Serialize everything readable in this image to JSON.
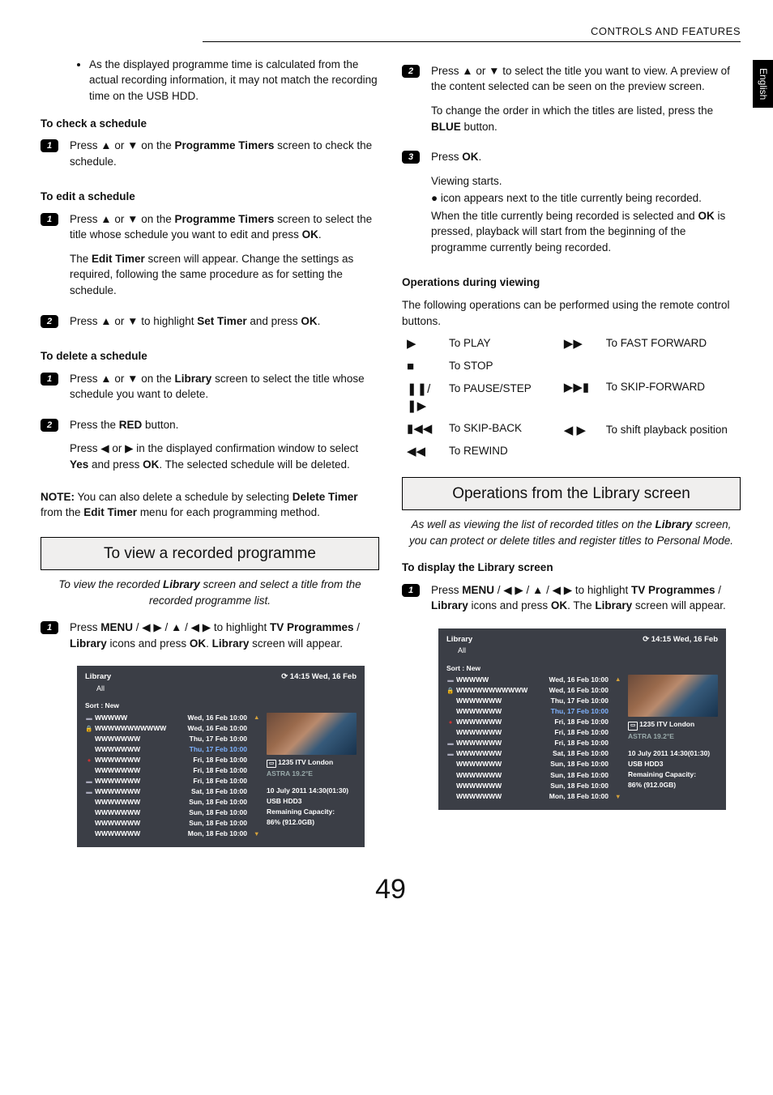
{
  "header": "CONTROLS AND FEATURES",
  "side_tab": "English",
  "page_number": "49",
  "left": {
    "bullet1": "As the displayed programme time is calculated from the actual recording information, it may not match the recording time on the USB HDD.",
    "h_check": "To check a schedule",
    "check1_a": "Press ▲ or ▼ on the ",
    "check1_b": "Programme Timers",
    "check1_c": " screen to check the schedule.",
    "h_edit": "To edit a schedule",
    "edit1_a": "Press ▲ or ▼ on the ",
    "edit1_b": "Programme Timers",
    "edit1_c": " screen to select the title whose schedule you want to edit and press ",
    "edit1_d": "OK",
    "edit1_e": ".",
    "edit1_p2a": "The ",
    "edit1_p2b": "Edit Timer",
    "edit1_p2c": " screen will appear. Change the settings as required, following the same procedure as for setting the schedule.",
    "edit2_a": "Press ▲ or ▼ to highlight ",
    "edit2_b": "Set Timer",
    "edit2_c": " and press ",
    "edit2_d": "OK",
    "edit2_e": ".",
    "h_del": "To delete a schedule",
    "del1_a": "Press ▲ or ▼ on the ",
    "del1_b": "Library",
    "del1_c": " screen to select the title whose schedule you want to delete.",
    "del2_a": "Press the ",
    "del2_b": "RED",
    "del2_c": " button.",
    "del2_p2a": "Press ◀ or ▶ in the displayed confirmation window to select ",
    "del2_p2b": "Yes",
    "del2_p2c": " and press ",
    "del2_p2d": "OK",
    "del2_p2e": ". The selected schedule will be deleted.",
    "note_a": "NOTE:",
    "note_b": " You can also delete a schedule by selecting ",
    "note_c": "Delete Timer",
    "note_d": " from the ",
    "note_e": "Edit Timer",
    "note_f": " menu for each programming method.",
    "sec_view": "To view a recorded programme",
    "sec_view_intro_a": "To view the recorded ",
    "sec_view_intro_b": "Library",
    "sec_view_intro_c": " screen and select a title from the recorded programme list.",
    "view1_a": "Press ",
    "view1_b": "MENU",
    "view1_c": " / ◀ ▶ / ▲ / ◀ ▶ to highlight ",
    "view1_d": "TV Programmes",
    "view1_e": " / ",
    "view1_f": "Library",
    "view1_g": " icons and press ",
    "view1_h": "OK",
    "view1_i": ". ",
    "view1_j": "Library",
    "view1_k": " screen will appear."
  },
  "right": {
    "r2_a": "Press ▲ or ▼ to select the title you want to view. A preview of the content selected can be seen on the preview screen.",
    "r2_b": "To change the order in which the titles are listed, press the ",
    "r2_c": "BLUE",
    "r2_d": " button.",
    "r3_a": "Press ",
    "r3_b": "OK",
    "r3_c": ".",
    "r3_p2": "Viewing starts.",
    "r3_p3": "● icon appears next to the title currently being recorded.",
    "r3_p4a": "When the title currently being recorded is selected and ",
    "r3_p4b": "OK",
    "r3_p4c": " is pressed, playback will start from the beginning of the programme currently being recorded.",
    "h_ops": "Operations during viewing",
    "ops_intro": "The following operations can be performed using the remote control buttons.",
    "ops_left": [
      {
        "icon": "▶",
        "label": "To PLAY"
      },
      {
        "icon": "■",
        "label": "To STOP"
      },
      {
        "icon": "❚❚/❚▶",
        "label": "To PAUSE/STEP"
      },
      {
        "icon": "▮◀◀",
        "label": "To SKIP-BACK"
      },
      {
        "icon": "◀◀",
        "label": "To REWIND"
      }
    ],
    "ops_right": [
      {
        "icon": "▶▶",
        "label": "To FAST FORWARD"
      },
      {
        "icon": "▶▶▮",
        "label": "To SKIP-FORWARD"
      },
      {
        "icon": "◀ ▶",
        "label": "To shift playback position"
      }
    ],
    "sec_lib": "Operations from the Library screen",
    "sec_lib_intro_a": "As well as viewing the list of recorded titles on the ",
    "sec_lib_intro_b": "Library",
    "sec_lib_intro_c": " screen, you can protect or delete titles and register titles to Personal Mode.",
    "h_disp": "To display the Library screen",
    "disp1_a": "Press ",
    "disp1_b": "MENU",
    "disp1_c": " / ◀ ▶ / ▲ / ◀ ▶ to highlight ",
    "disp1_d": "TV Programmes",
    "disp1_e": " / ",
    "disp1_f": "Library",
    "disp1_g": " icons and press ",
    "disp1_h": "OK",
    "disp1_i": ". The ",
    "disp1_j": "Library",
    "disp1_k": " screen will appear."
  },
  "library": {
    "title": "Library",
    "time": "14:15 Wed, 16 Feb",
    "sub": "All",
    "sort": "Sort : New",
    "rows": [
      {
        "icon": "▬",
        "name": "WWWWW",
        "date": "Wed, 16 Feb 10:00",
        "blue": false
      },
      {
        "icon": "lock",
        "name": "WWWWWWWWWWW",
        "date": "Wed, 16 Feb 10:00",
        "blue": false
      },
      {
        "icon": "",
        "name": "WWWWWWW",
        "date": "Thu, 17 Feb 10:00",
        "blue": false
      },
      {
        "icon": "",
        "name": "WWWWWWW",
        "date": "Thu, 17 Feb 10:00",
        "blue": true
      },
      {
        "icon": "rec",
        "name": "WWWWWWW",
        "date": "Fri, 18 Feb 10:00",
        "blue": false
      },
      {
        "icon": "",
        "name": "WWWWWWW",
        "date": "Fri, 18 Feb 10:00",
        "blue": false
      },
      {
        "icon": "▬",
        "name": "WWWWWWW",
        "date": "Fri, 18 Feb 10:00",
        "blue": false
      },
      {
        "icon": "▬",
        "name": "WWWWWWW",
        "date": "Sat, 18 Feb 10:00",
        "blue": false
      },
      {
        "icon": "",
        "name": "WWWWWWW",
        "date": "Sun, 18 Feb 10:00",
        "blue": false
      },
      {
        "icon": "",
        "name": "WWWWWWW",
        "date": "Sun, 18 Feb 10:00",
        "blue": false
      },
      {
        "icon": "",
        "name": "WWWWWWW",
        "date": "Sun, 18 Feb 10:00",
        "blue": false
      },
      {
        "icon": "",
        "name": "WWWWWWW",
        "date": "Mon, 18 Feb 10:00",
        "blue": false
      }
    ],
    "channel": "1235 ITV London",
    "sat": "ASTRA 19.2°E",
    "rec_info": "10 July 2011  14:30(01:30)",
    "usb": "USB HDD3",
    "cap_label": "Remaining Capacity:",
    "cap_val": "86% (912.0GB)"
  }
}
